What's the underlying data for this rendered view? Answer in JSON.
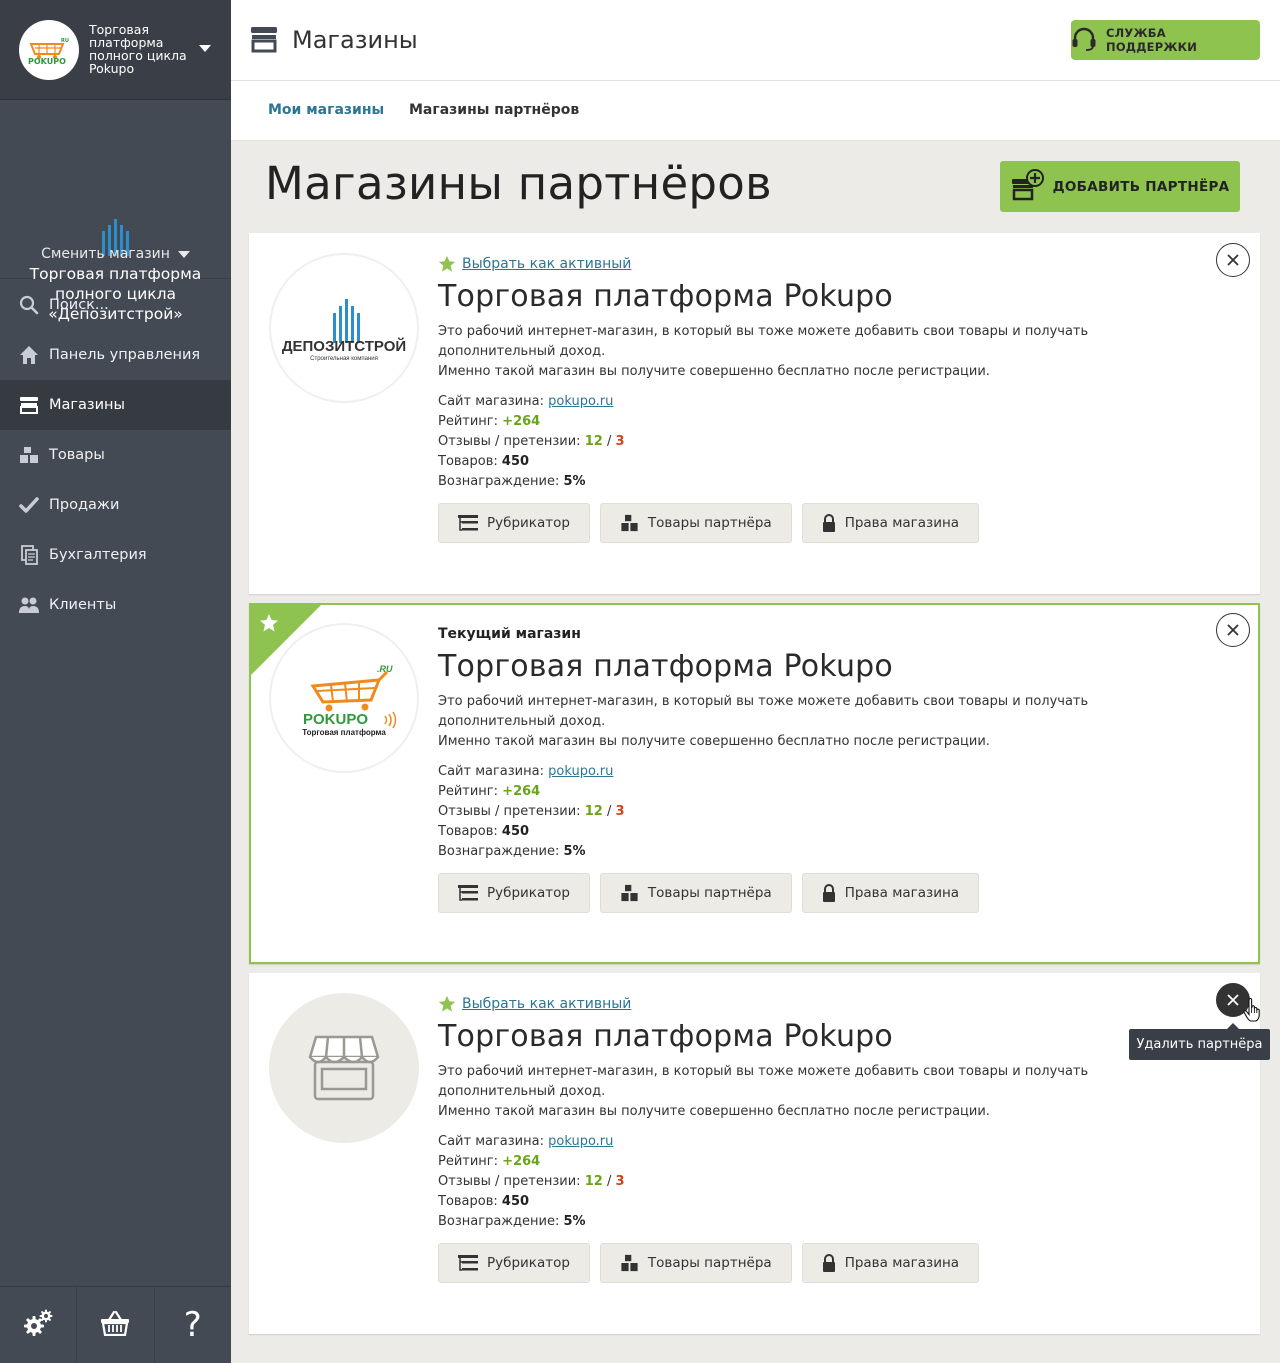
{
  "sidebar": {
    "header_title": "Торговая платформа полного цикла Pokupo",
    "company_name": "Торговая платформа полного цикла «Депозитстрой»",
    "switch_label": "Сменить магазин",
    "nav": [
      {
        "label": "Поиск...",
        "icon": "search-icon"
      },
      {
        "label": "Панель управления",
        "icon": "home-icon"
      },
      {
        "label": "Магазины",
        "icon": "store-icon",
        "active": true
      },
      {
        "label": "Товары",
        "icon": "boxes-icon"
      },
      {
        "label": "Продажи",
        "icon": "check-icon"
      },
      {
        "label": "Бухгалтерия",
        "icon": "documents-icon"
      },
      {
        "label": "Клиенты",
        "icon": "users-icon"
      }
    ],
    "bottom": [
      "gear-icon",
      "basket-icon",
      "help-icon"
    ],
    "help_glyph": "?"
  },
  "header": {
    "title": "Магазины",
    "support_label": "СЛУЖБА ПОДДЕРЖКИ"
  },
  "tabs": [
    {
      "label": "Мои магазины",
      "active": true
    },
    {
      "label": "Магазины партнёров",
      "active": false
    }
  ],
  "page": {
    "title": "Магазины партнёров",
    "add_partner_label": "ДОБАВИТЬ ПАРТНЁРА"
  },
  "logos": {
    "deposit": {
      "name": "ДЕПОЗИТСТРОЙ",
      "tagline": "Строительная компания"
    },
    "pokupo": {
      "name": "POKUPO",
      "suffix": ".RU",
      "tagline": "Торговая платформа"
    }
  },
  "labels": {
    "select_active": "Выбрать как активный",
    "current_shop": "Текущий магазин",
    "site": "Сайт магазина:",
    "rating": "Рейтинг:",
    "reviews": "Отзывы / претензии:",
    "goods": "Товаров:",
    "reward": "Вознаграждение:",
    "btn_rubricator": "Рубрикатор",
    "btn_partner_goods": "Товары партнёра",
    "btn_rights": "Права магазина"
  },
  "cards": [
    {
      "name": "Торговая платформа Pokupo",
      "desc_line1": "Это рабочий интернет-магазин, в который вы тоже можете добавить свои товары и получать дополнительный доход.",
      "desc_line2": "Именно такой магазин вы получите совершенно бесплатно после регистрации.",
      "site": "pokupo.ru",
      "rating": "+264",
      "reviews": "12",
      "claims": "3",
      "sep": "/",
      "goods": "450",
      "reward": "5%"
    },
    {
      "name": "Торговая платформа Pokupo",
      "desc_line1": "Это рабочий интернет-магазин, в который вы тоже можете добавить свои товары и получать дополнительный доход.",
      "desc_line2": "Именно такой магазин вы получите совершенно бесплатно после регистрации.",
      "site": "pokupo.ru",
      "rating": "+264",
      "reviews": "12",
      "claims": "3",
      "sep": "/",
      "goods": "450",
      "reward": "5%"
    },
    {
      "name": "Торговая платформа Pokupo",
      "desc_line1": "Это рабочий интернет-магазин, в который вы тоже можете добавить свои товары и получать дополнительный доход.",
      "desc_line2": "Именно такой магазин вы получите совершенно бесплатно после регистрации.",
      "site": "pokupo.ru",
      "rating": "+264",
      "reviews": "12",
      "claims": "3",
      "sep": "/",
      "goods": "450",
      "reward": "5%"
    }
  ],
  "tooltip": "Удалить партнёра",
  "colors": {
    "accent": "#8fc34f",
    "link": "#2b7693",
    "sidebar": "#444a53",
    "positive": "#6aa41a",
    "negative": "#d0451b"
  }
}
